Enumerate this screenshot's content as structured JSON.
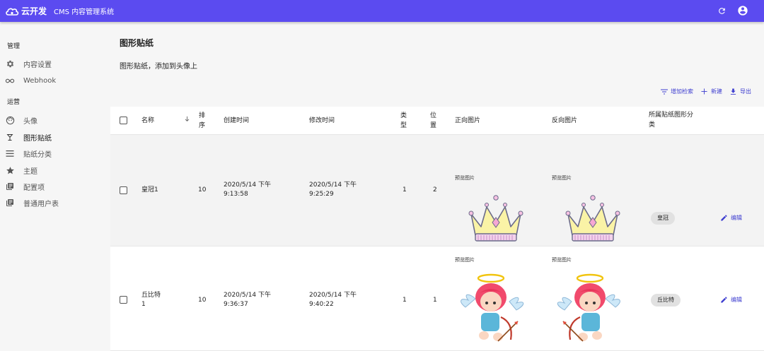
{
  "appbar": {
    "brand_name": "云开发",
    "title": "CMS 内容管理系统",
    "actions": [
      {
        "icon": "refresh-icon"
      },
      {
        "icon": "account-circle-icon"
      }
    ],
    "color": "#5b4bf0"
  },
  "sidebar": {
    "group_manage": "管理",
    "group_ops": "运营",
    "items": [
      {
        "label": "内容设置",
        "icon": "gear-icon"
      },
      {
        "label": "Webhook",
        "icon": "infinity-icon"
      },
      {
        "label": "头像",
        "icon": "face-icon"
      },
      {
        "label": "图形贴纸",
        "icon": "cocktail-icon",
        "active": true
      },
      {
        "label": "贴纸分类",
        "icon": "list-icon"
      },
      {
        "label": "主题",
        "icon": "star-icon"
      },
      {
        "label": "配置项",
        "icon": "collection-icon"
      },
      {
        "label": "普通用户表",
        "icon": "collection-icon"
      }
    ]
  },
  "page": {
    "title": "图形贴纸",
    "description": "图形贴纸，添加到头像上"
  },
  "toolbar": {
    "add_search": "增加检索",
    "new": "新建",
    "export": "导出"
  },
  "table": {
    "headers": {
      "name": "名称",
      "order_l1": "排",
      "order_l2": "序",
      "created": "创建时间",
      "modified": "修改时间",
      "type_l1": "类",
      "type_l2": "型",
      "pos_l1": "位",
      "pos_l2": "置",
      "front": "正向图片",
      "back": "反向图片",
      "category_l1": "所属贴纸图形分",
      "category_l2": "类"
    },
    "rows": [
      {
        "name_l1": "皇冠1",
        "name_l2": "",
        "order": "10",
        "created_l1": "2020/5/14 下午",
        "created_l2": "9:13:58",
        "modified_l1": "2020/5/14 下午",
        "modified_l2": "9:25:29",
        "type": "1",
        "position": "2",
        "front_label": "预览图片",
        "back_label": "预览图片",
        "category": "皇冠",
        "edit": "编辑"
      },
      {
        "name_l1": "丘比特",
        "name_l2": "1",
        "order": "10",
        "created_l1": "2020/5/14 下午",
        "created_l2": "9:36:37",
        "modified_l1": "2020/5/14 下午",
        "modified_l2": "9:40:22",
        "type": "1",
        "position": "1",
        "front_label": "预览图片",
        "back_label": "预览图片",
        "category": "丘比特",
        "edit": "编辑"
      }
    ]
  }
}
